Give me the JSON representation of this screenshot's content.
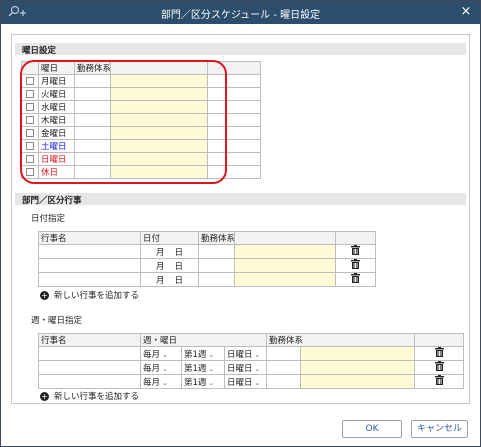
{
  "window": {
    "title": "部門／区分スケジュール - 曜日設定",
    "close_glyph": "×"
  },
  "weekday_section": {
    "header": "曜日設定",
    "columns": [
      "曜日",
      "勤務体系"
    ],
    "rows": [
      {
        "day": "月曜日",
        "color": "#222222"
      },
      {
        "day": "火曜日",
        "color": "#222222"
      },
      {
        "day": "水曜日",
        "color": "#222222"
      },
      {
        "day": "木曜日",
        "color": "#222222"
      },
      {
        "day": "金曜日",
        "color": "#222222"
      },
      {
        "day": "土曜日",
        "color": "#1a22e0"
      },
      {
        "day": "日曜日",
        "color": "#e0141b"
      },
      {
        "day": "休日",
        "color": "#e0141b"
      }
    ]
  },
  "event_section": {
    "header": "部門／区分行事",
    "date_spec": {
      "label": "日付指定",
      "columns": [
        "行事名",
        "日付",
        "勤務体系"
      ],
      "month_label": "月",
      "day_label": "日",
      "add_label": "新しい行事を追加する"
    },
    "week_spec": {
      "label": "週・曜日指定",
      "columns": [
        "行事名",
        "週・曜日",
        "勤務体系"
      ],
      "month_value": "毎月",
      "week_value": "第1週",
      "weekday_value": "日曜日",
      "add_label": "新しい行事を追加する"
    }
  },
  "footer": {
    "ok_label": "OK",
    "cancel_label": "キャンセル"
  },
  "icons": {
    "title_icon": "search-plus-icon",
    "trash": "trash-icon",
    "add": "plus-circle-icon",
    "caret": "chevron-down-icon"
  }
}
